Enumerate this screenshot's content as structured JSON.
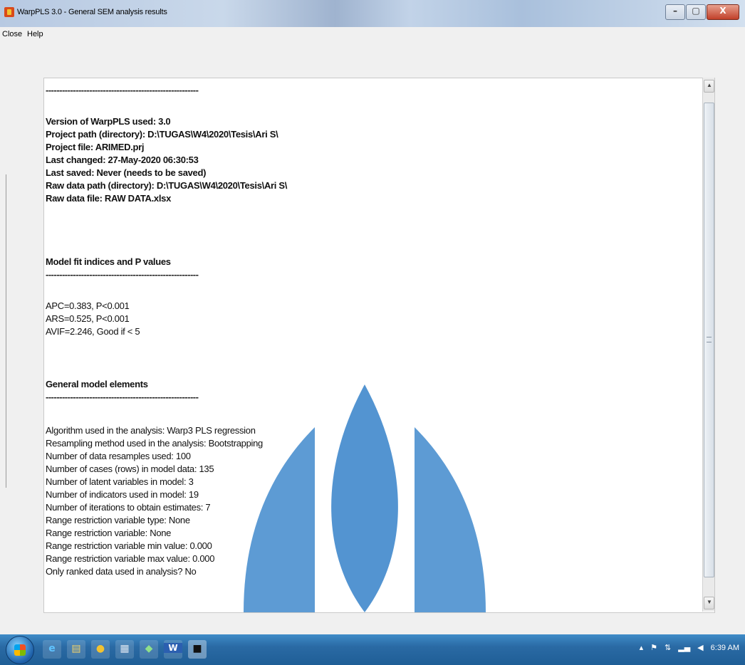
{
  "window": {
    "title": "WarpPLS 3.0 - General SEM analysis results",
    "minimize_symbol": "–",
    "maximize_symbol": "▢",
    "close_symbol": "X"
  },
  "menu": {
    "close_label": "Close",
    "help_label": "Help"
  },
  "content": {
    "partial_header": "",
    "dash_line": "--------------------------------------------------------",
    "project_lines": [
      "Version of WarpPLS used: 3.0",
      "Project path (directory): D:\\TUGAS\\W4\\2020\\Tesis\\Ari S\\",
      "Project file: ARIMED.prj",
      "Last changed: 27-May-2020 06:30:53",
      "Last saved: Never (needs to be saved)",
      "Raw data path (directory): D:\\TUGAS\\W4\\2020\\Tesis\\Ari S\\",
      "Raw data file: RAW DATA.xlsx"
    ],
    "fit_heading": "Model fit indices and P values",
    "fit_lines": [
      "APC=0.383, P<0.001",
      "ARS=0.525, P<0.001",
      "AVIF=2.246, Good if < 5"
    ],
    "elements_heading": "General model elements",
    "element_lines": [
      "Algorithm used in the analysis: Warp3 PLS regression",
      "Resampling method used in the analysis: Bootstrapping",
      "Number of data resamples used: 100",
      "Number of cases (rows) in model data: 135",
      "Number of latent variables in model: 3",
      "Number of indicators used in model: 19",
      "Number of iterations to obtain estimates: 7",
      "Range restriction variable type: None",
      "Range restriction variable: None",
      "Range restriction variable min value: 0.000",
      "Range restriction variable max value: 0.000",
      "Only ranked data used in analysis? No"
    ]
  },
  "taskbar": {
    "clock": "6:39 AM",
    "apps": [
      "internet-explorer-icon",
      "file-explorer-icon",
      "chrome-icon",
      "calculator-icon",
      "paint-icon",
      "word-icon",
      "warppls-icon"
    ]
  },
  "colors": {
    "taskbar": "#2a6aa4",
    "watermark_blue": "#2b7cc7"
  }
}
